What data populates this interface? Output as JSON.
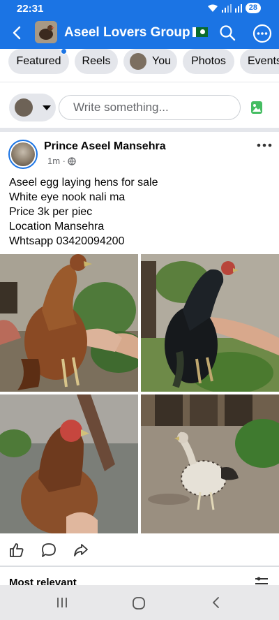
{
  "status_bar": {
    "time": "22:31",
    "battery": "28"
  },
  "header": {
    "group_name": "Aseel Lovers Group",
    "flag_icon": "pakistan-flag-icon",
    "accent_color": "#1b74e4"
  },
  "tabs": [
    {
      "label": "Featured",
      "has_notification_dot": true
    },
    {
      "label": "Reels"
    },
    {
      "label": "You"
    },
    {
      "label": "Photos"
    },
    {
      "label": "Events"
    }
  ],
  "composer": {
    "placeholder": "Write something..."
  },
  "post": {
    "author": "Prince Aseel Mansehra",
    "time": "1m",
    "audience_icon": "globe-icon",
    "lines": [
      "Aseel egg laying hens for sale",
      "White eye nook nali ma",
      "Price 3k per piec",
      "Location Mansehra",
      "Whtsapp 03420094200"
    ],
    "photos": [
      {
        "alt": "red-brown hen held in hand"
      },
      {
        "alt": "black hen held in hand"
      },
      {
        "alt": "brown hen close-up"
      },
      {
        "alt": "white speckled hen on ground"
      }
    ]
  },
  "comments": {
    "sort_label": "Most relevant"
  }
}
